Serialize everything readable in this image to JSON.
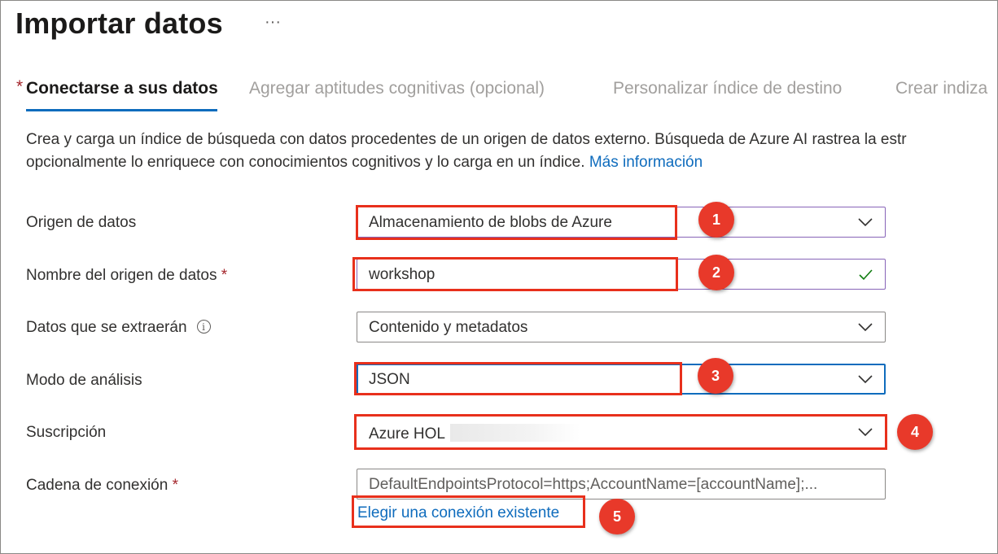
{
  "page": {
    "title": "Importar datos",
    "more_label": "···"
  },
  "tabs": [
    {
      "label": "Conectarse a sus datos",
      "required_marker": "*",
      "active": true
    },
    {
      "label": "Agregar aptitudes cognitivas (opcional)",
      "active": false
    },
    {
      "label": "Personalizar índice de destino",
      "active": false
    },
    {
      "label": "Crear indiza",
      "active": false
    }
  ],
  "description": {
    "line1": "Crea y carga un índice de búsqueda con datos procedentes de un origen de datos externo. Búsqueda de Azure AI rastrea la estr",
    "line2": "opcionalmente lo enriquece con conocimientos cognitivos y lo carga en un índice.",
    "link": "Más información"
  },
  "form": {
    "data_source": {
      "label": "Origen de datos",
      "value": "Almacenamiento de blobs de Azure"
    },
    "data_source_name": {
      "label": "Nombre del origen de datos",
      "required": "*",
      "value": "workshop"
    },
    "data_to_extract": {
      "label": "Datos que se extraerán",
      "info": "i",
      "value": "Contenido y metadatos"
    },
    "parsing_mode": {
      "label": "Modo de análisis",
      "value": "JSON"
    },
    "subscription": {
      "label": "Suscripción",
      "value": "Azure HOL"
    },
    "connection_string": {
      "label": "Cadena de conexión",
      "required": "*",
      "placeholder": "DefaultEndpointsProtocol=https;AccountName=[accountName];..."
    },
    "choose_connection_link": "Elegir una conexión existente"
  },
  "callouts": [
    "1",
    "2",
    "3",
    "4",
    "5"
  ],
  "colors": {
    "accent": "#0f6cbd",
    "callout": "#e8392a",
    "highlight_box": "#e8301c",
    "valid_check": "#107c10",
    "focus_purple": "#8764b8"
  }
}
